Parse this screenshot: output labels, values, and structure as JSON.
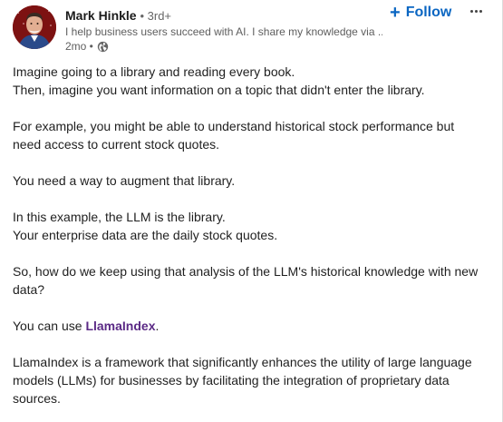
{
  "author": {
    "name": "Mark Hinkle",
    "degree": "• 3rd+",
    "headline": "I help business users succeed with AI. I share my knowledge via ...",
    "time": "2mo •"
  },
  "actions": {
    "follow_label": "Follow",
    "follow_plus": "+",
    "more_icon": "more-horizontal-icon"
  },
  "colors": {
    "accent": "#0a66c2",
    "link": "#5b2a86"
  },
  "post": {
    "p1_line1": "Imagine going to a library and reading every book.",
    "p1_line2": "Then, imagine you want information on a topic that didn't enter the library.",
    "p2_line1": "For example, you might be able to understand historical stock performance but",
    "p2_line2": "need access to current stock quotes.",
    "p3": "You need a way to augment that library.",
    "p4_line1": "In this example, the LLM is the library.",
    "p4_line2": "Your enterprise data are the daily stock quotes.",
    "p5_line1": "So, how do we keep using that analysis of the LLM's historical knowledge with new",
    "p5_line2": "data?",
    "p6_prefix": "You can use ",
    "p6_link": "LlamaIndex",
    "p6_suffix": ".",
    "p7_line1": "LlamaIndex is a framework that significantly enhances the utility of large language",
    "p7_line2": "models (LLMs) for businesses by facilitating the integration of proprietary data",
    "p7_line3": "sources."
  }
}
